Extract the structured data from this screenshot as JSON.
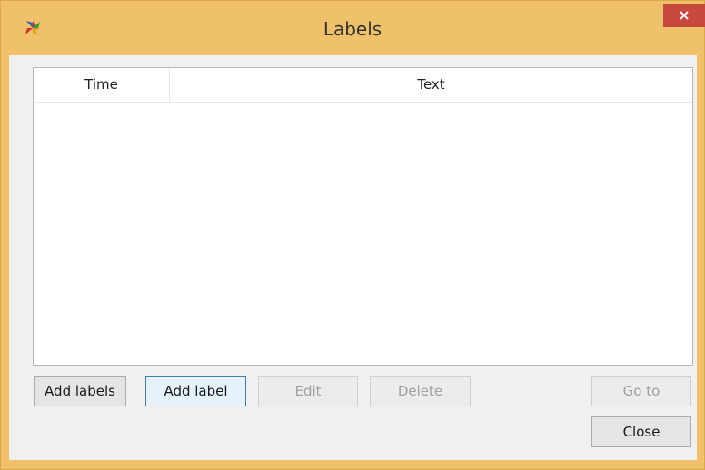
{
  "window": {
    "title": "Labels",
    "app_icon": "colored-pinwheel-icon",
    "close_glyph": "×",
    "accent_color": "#efc16a",
    "close_color": "#c9483e"
  },
  "list": {
    "columns": [
      "Time",
      "Text"
    ],
    "rows": []
  },
  "buttons": {
    "add_labels": "Add labels",
    "add_label": "Add label",
    "edit": "Edit",
    "delete": "Delete",
    "go_to": "Go to",
    "close": "Close"
  }
}
